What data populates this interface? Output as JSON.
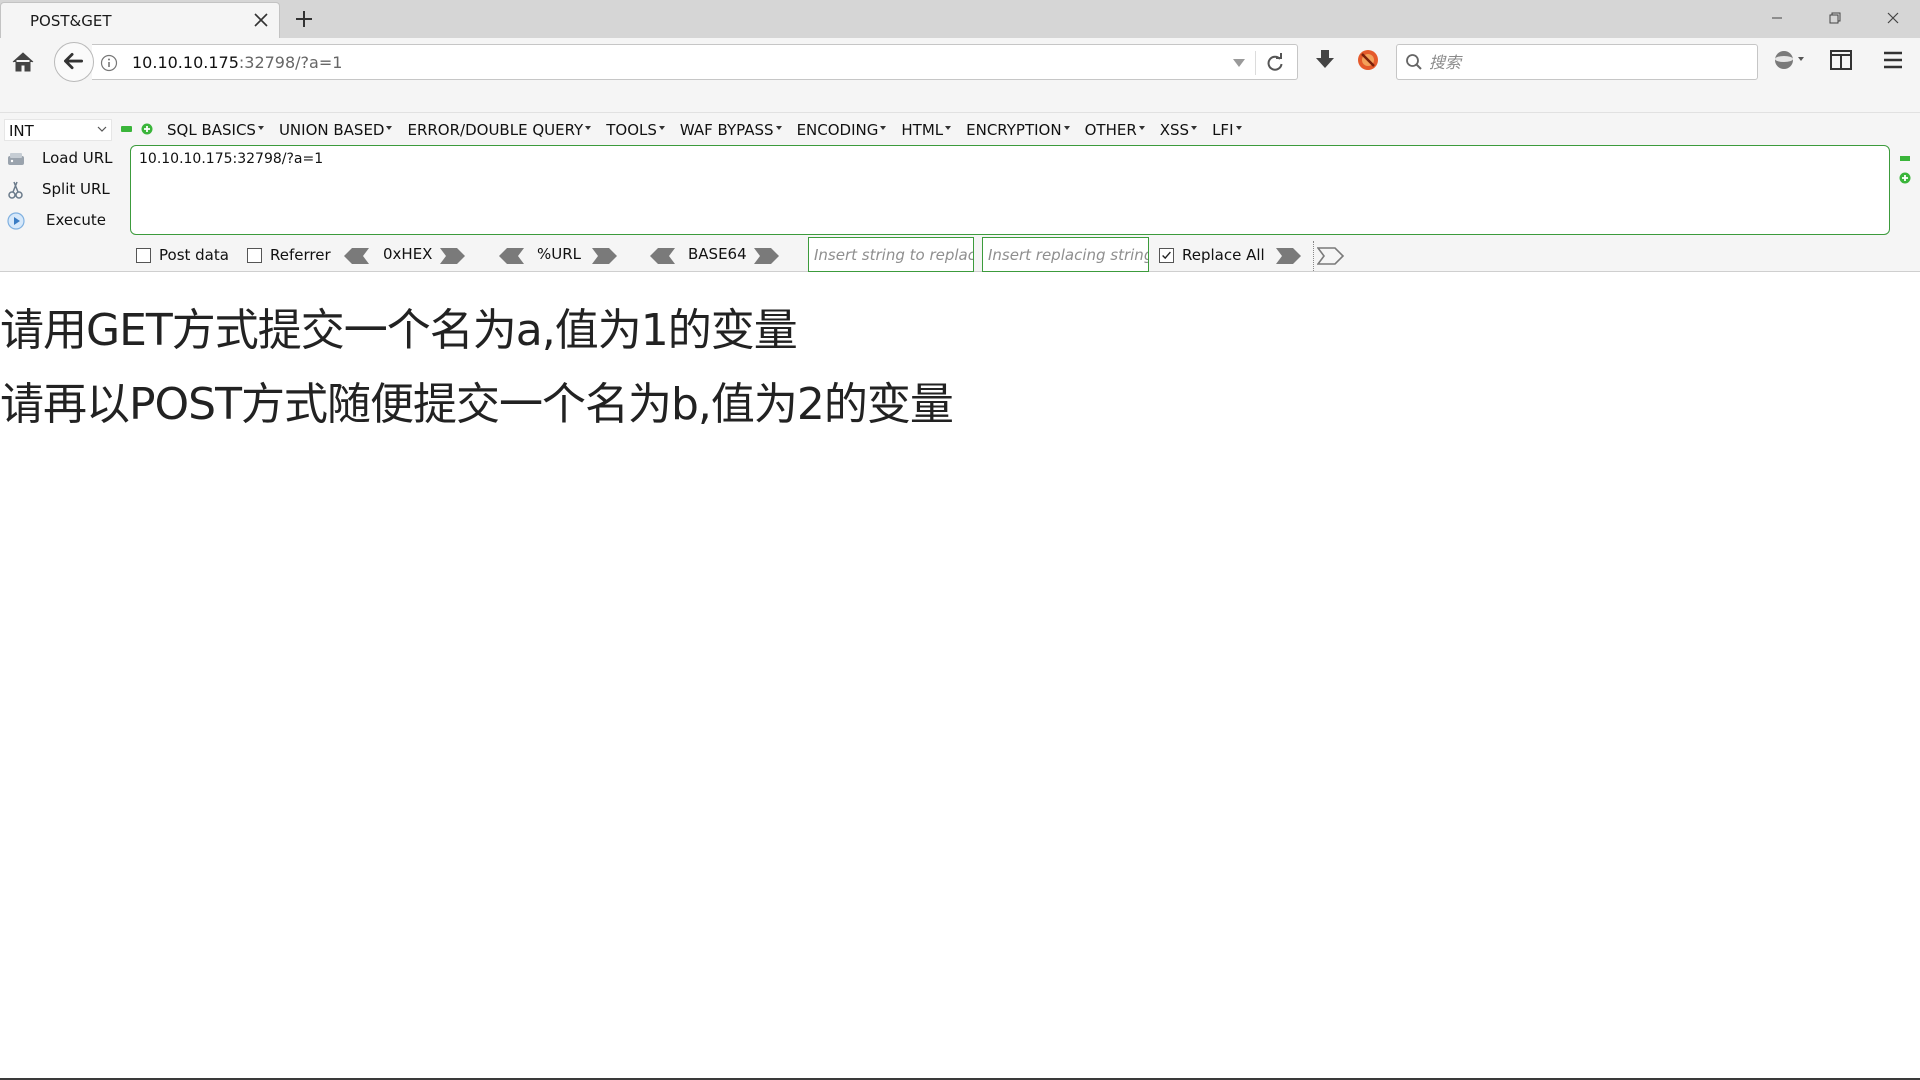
{
  "browser": {
    "tab_title": "POST&GET",
    "url_host": "10.10.10.175",
    "url_rest": ":32798/?a=1",
    "search_placeholder": "搜索"
  },
  "hackbar": {
    "selected_type": "INT",
    "menus": [
      "SQL BASICS",
      "UNION BASED",
      "ERROR/DOUBLE QUERY",
      "TOOLS",
      "WAF BYPASS",
      "ENCODING",
      "HTML",
      "ENCRYPTION",
      "OTHER",
      "XSS",
      "LFI"
    ],
    "actions": {
      "load_url": "Load URL",
      "split_url": "Split URL",
      "execute": "Execute"
    },
    "url_value": "10.10.10.175:32798/?a=1",
    "post_data_label": "Post data",
    "post_data_checked": false,
    "referrer_label": "Referrer",
    "referrer_checked": false,
    "codecs": [
      "0xHEX",
      "%URL",
      "BASE64"
    ],
    "replace_from_placeholder": "Insert string to replace",
    "replace_to_placeholder": "Insert replacing string",
    "replace_all_label": "Replace All",
    "replace_all_checked": true
  },
  "page": {
    "line1": "请用GET方式提交一个名为a,值为1的变量",
    "line2": "请再以POST方式随便提交一个名为b,值为2的变量"
  },
  "colors": {
    "accent_green": "#3c9b3c",
    "tabstrip_bg": "#d6d6d6",
    "toolbar_bg": "#f5f5f5"
  }
}
